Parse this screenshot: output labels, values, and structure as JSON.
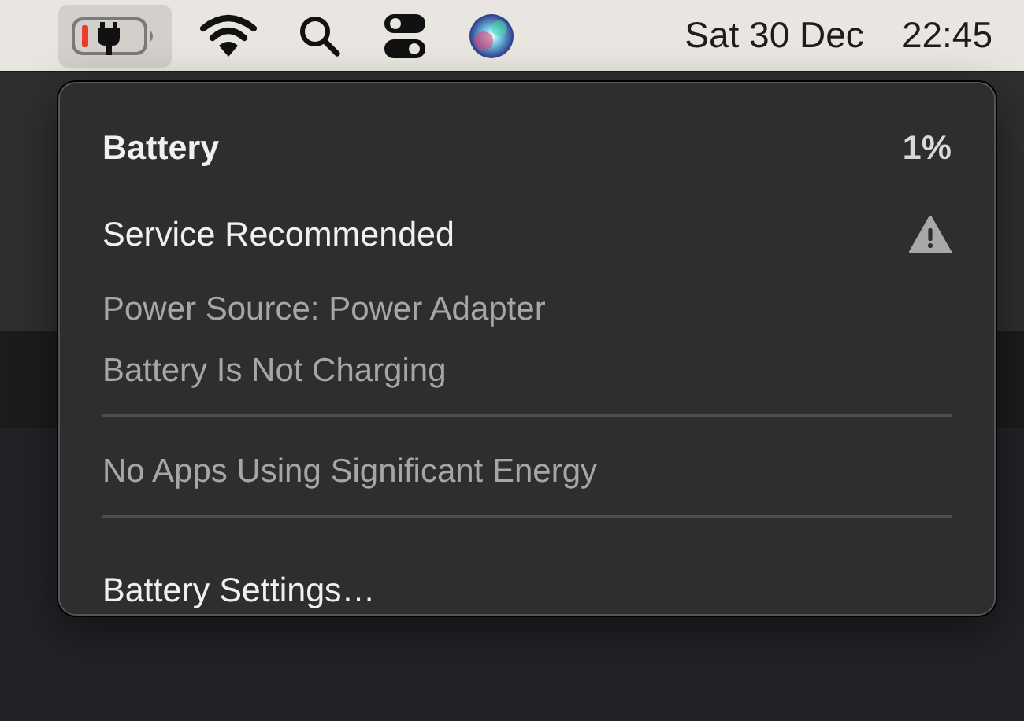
{
  "menu_bar": {
    "status_items": [
      {
        "kind": "battery",
        "selected": true
      },
      {
        "kind": "wifi",
        "selected": false
      },
      {
        "kind": "search",
        "selected": false
      },
      {
        "kind": "control-center",
        "selected": false
      },
      {
        "kind": "siri",
        "selected": false
      }
    ],
    "date": "Sat 30 Dec",
    "time": "22:45"
  },
  "battery_menu": {
    "title": "Battery",
    "percent": "1%",
    "rows": [
      {
        "kind": "heading",
        "text": "Service Recommended",
        "warning": true
      },
      {
        "kind": "detail",
        "text": "Power Source: Power Adapter"
      },
      {
        "kind": "detail",
        "text": "Battery Is Not Charging"
      },
      {
        "kind": "separator"
      },
      {
        "kind": "detail",
        "text": "No Apps Using Significant Energy"
      },
      {
        "kind": "separator"
      },
      {
        "kind": "action",
        "text": "Battery Settings…"
      }
    ]
  }
}
